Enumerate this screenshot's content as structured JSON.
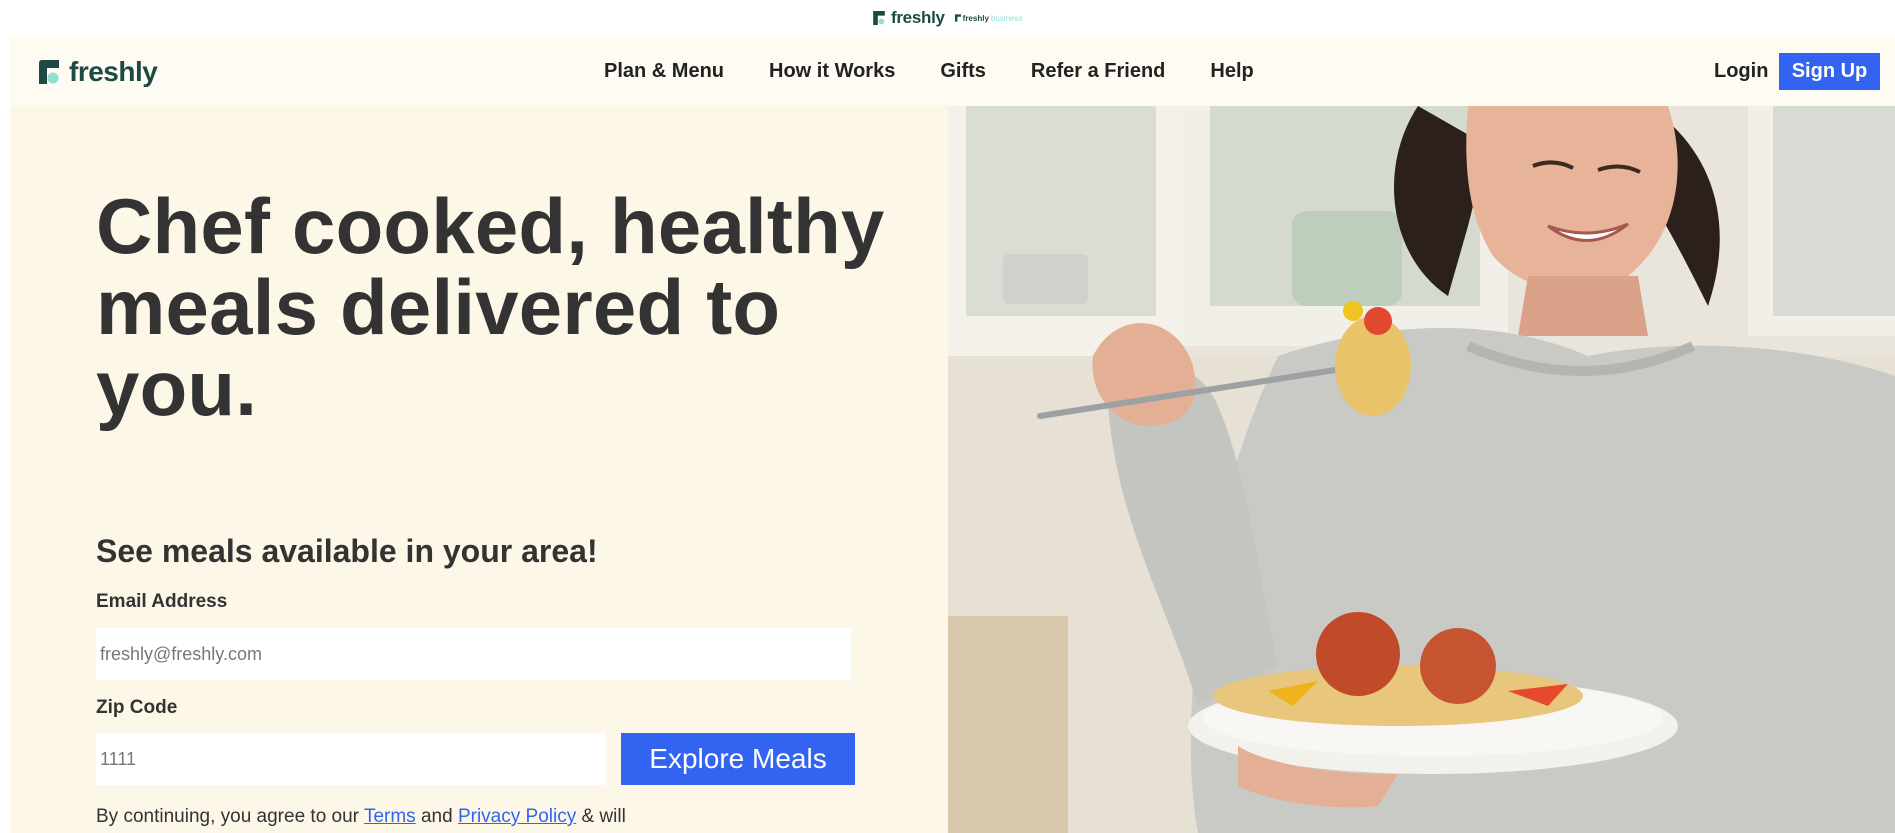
{
  "top_brand": {
    "wordmark": "freshly",
    "sub_logo_a": "freshly",
    "sub_logo_b": "business"
  },
  "header": {
    "brand": "freshly",
    "nav": [
      "Plan & Menu",
      "How it Works",
      "Gifts",
      "Refer a Friend",
      "Help"
    ],
    "login": "Login",
    "signup": "Sign Up"
  },
  "hero": {
    "headline": "Chef cooked, healthy meals delivered to you.",
    "subhead": "See meals available in your area!",
    "email_label": "Email Address",
    "email_placeholder": "freshly@freshly.com",
    "zip_label": "Zip Code",
    "zip_value": "1111",
    "cta": "Explore Meals",
    "legal": {
      "prefix": "By continuing, you agree to our ",
      "terms": "Terms",
      "and": " and ",
      "privacy": "Privacy Policy",
      "suffix": " & will"
    }
  },
  "colors": {
    "brand_green": "#1d4a45",
    "accent_blue": "#3364f1",
    "hero_bg": "#fdf7e8",
    "header_bg": "#fdfbf2"
  },
  "icons": {
    "brand_logo": "freshly-logo-icon"
  }
}
